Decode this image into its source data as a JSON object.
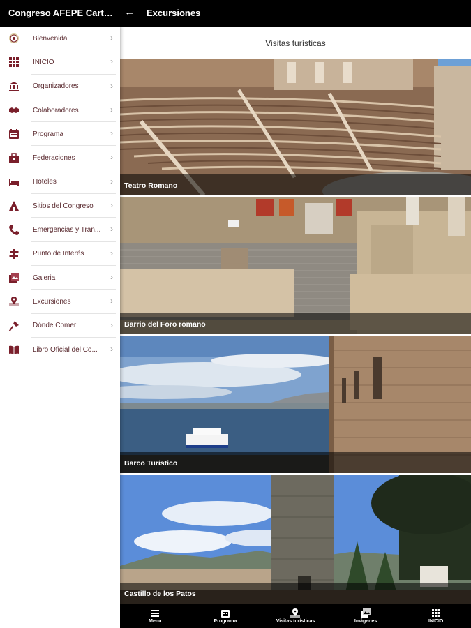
{
  "header": {
    "app_title": "Congreso AFEPE Cartag...",
    "back_icon": "arrow-left-icon",
    "page_title": "Excursiones"
  },
  "sidebar": {
    "items": [
      {
        "label": "Bienvenida",
        "icon": "seal-icon"
      },
      {
        "label": "INICIO",
        "icon": "grid-icon"
      },
      {
        "label": "Organizadores",
        "icon": "institution-icon"
      },
      {
        "label": "Colaboradores",
        "icon": "handshake-icon"
      },
      {
        "label": "Programa",
        "icon": "calendar-icon"
      },
      {
        "label": "Federaciones",
        "icon": "briefcase-icon"
      },
      {
        "label": "Hoteles",
        "icon": "bed-icon"
      },
      {
        "label": "Sitios del Congreso",
        "icon": "pyramid-icon"
      },
      {
        "label": "Emergencias y Tran...",
        "icon": "phone-icon"
      },
      {
        "label": "Punto de Interés",
        "icon": "signpost-icon"
      },
      {
        "label": "Galeria",
        "icon": "gallery-icon"
      },
      {
        "label": "Excursiones",
        "icon": "map-pin-icon"
      },
      {
        "label": "Dónde Comer",
        "icon": "fork-icon"
      },
      {
        "label": "Libro Oficial del Co...",
        "icon": "book-icon"
      }
    ]
  },
  "main": {
    "section_title": "Visitas turísticas",
    "cards": [
      {
        "caption": "Teatro Romano"
      },
      {
        "caption": "Barrio del Foro romano"
      },
      {
        "caption": "Barco Turístico"
      },
      {
        "caption": "Castillo de los Patos"
      }
    ]
  },
  "bottom_nav": [
    {
      "label": "Menu",
      "icon": "menu-icon"
    },
    {
      "label": "Programa",
      "icon": "calendar-icon"
    },
    {
      "label": "Visitas turísticas",
      "icon": "map-pin-icon"
    },
    {
      "label": "Imágenes",
      "icon": "image-icon"
    },
    {
      "label": "INICIO",
      "icon": "grid-icon"
    }
  ],
  "colors": {
    "accent": "#7a1f2b",
    "bar": "#000000"
  }
}
